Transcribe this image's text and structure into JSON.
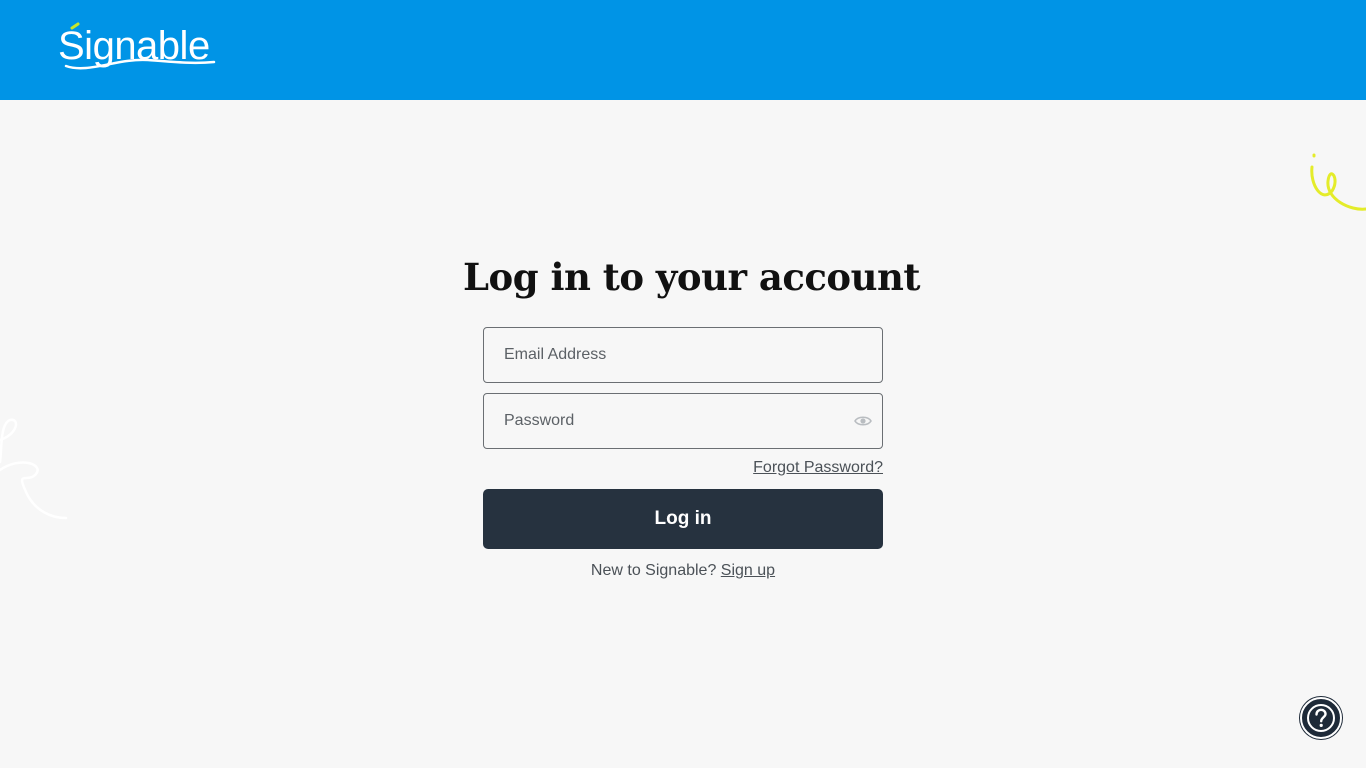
{
  "header": {
    "logo_text": "Signable",
    "brand_color": "#0094e6"
  },
  "login": {
    "title": "Log in to your account",
    "email_placeholder": "Email Address",
    "email_value": "",
    "password_placeholder": "Password",
    "password_value": "",
    "forgot_password": "Forgot Password?",
    "submit_label": "Log in",
    "signup_prompt": "New to Signable?",
    "signup_link": "Sign up"
  },
  "icons": {
    "password_toggle": "eye-icon",
    "help": "help-icon"
  },
  "colors": {
    "button_bg": "#26323f",
    "accent_squiggle": "#e4ec2a",
    "page_bg": "#f7f7f7"
  }
}
